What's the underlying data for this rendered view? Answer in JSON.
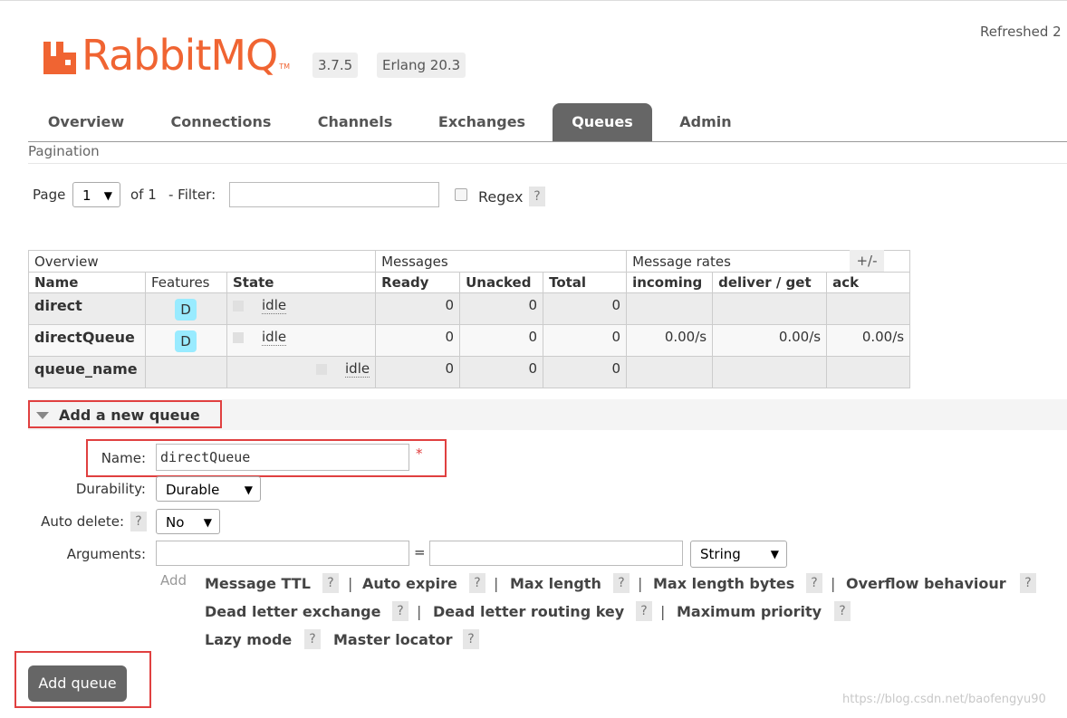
{
  "header": {
    "logo_text": "RabbitMQ",
    "logo_tm": "TM",
    "version": "3.7.5",
    "erlang": "Erlang 20.3",
    "refreshed": "Refreshed 2"
  },
  "nav": {
    "tabs": [
      "Overview",
      "Connections",
      "Channels",
      "Exchanges",
      "Queues",
      "Admin"
    ],
    "active": "Queues"
  },
  "pagination": {
    "title": "Pagination",
    "page_label": "Page",
    "page_value": "1",
    "of_label": "of 1",
    "filter_label": "- Filter:",
    "filter_value": "",
    "regex_label": "Regex",
    "help": "?"
  },
  "table": {
    "group_headers": [
      "Overview",
      "Messages",
      "Message rates"
    ],
    "columns": [
      "Name",
      "Features",
      "State",
      "Ready",
      "Unacked",
      "Total",
      "incoming",
      "deliver / get",
      "ack"
    ],
    "plusminus": "+/-",
    "rows": [
      {
        "name": "direct",
        "feature": "D",
        "state": "idle",
        "ready": "0",
        "unacked": "0",
        "total": "0",
        "incoming": "",
        "deliver": "",
        "ack": ""
      },
      {
        "name": "directQueue",
        "feature": "D",
        "state": "idle",
        "ready": "0",
        "unacked": "0",
        "total": "0",
        "incoming": "0.00/s",
        "deliver": "0.00/s",
        "ack": "0.00/s"
      },
      {
        "name": "queue_name",
        "feature": "",
        "state": "idle",
        "ready": "0",
        "unacked": "0",
        "total": "0",
        "incoming": "",
        "deliver": "",
        "ack": ""
      }
    ]
  },
  "add_queue": {
    "section_title": "Add a new queue",
    "name_label": "Name:",
    "name_value": "directQueue",
    "required_mark": "*",
    "durability_label": "Durability:",
    "durability_value": "Durable",
    "auto_delete_label": "Auto delete:",
    "auto_delete_value": "No",
    "arguments_label": "Arguments:",
    "equals": "=",
    "arg_type": "String",
    "add_label": "Add",
    "arg_links": [
      "Message TTL",
      "Auto expire",
      "Max length",
      "Max length bytes",
      "Overflow behaviour",
      "Dead letter exchange",
      "Dead letter routing key",
      "Maximum priority",
      "Lazy mode",
      "Master locator"
    ],
    "submit_label": "Add queue",
    "help": "?",
    "pipe": "|"
  },
  "watermark": "https://blog.csdn.net/baofengyu90",
  "colors": {
    "brand": "#f06432",
    "active_tab": "#666666",
    "highlight_box": "#e04040",
    "feature_badge": "#99ebff"
  }
}
